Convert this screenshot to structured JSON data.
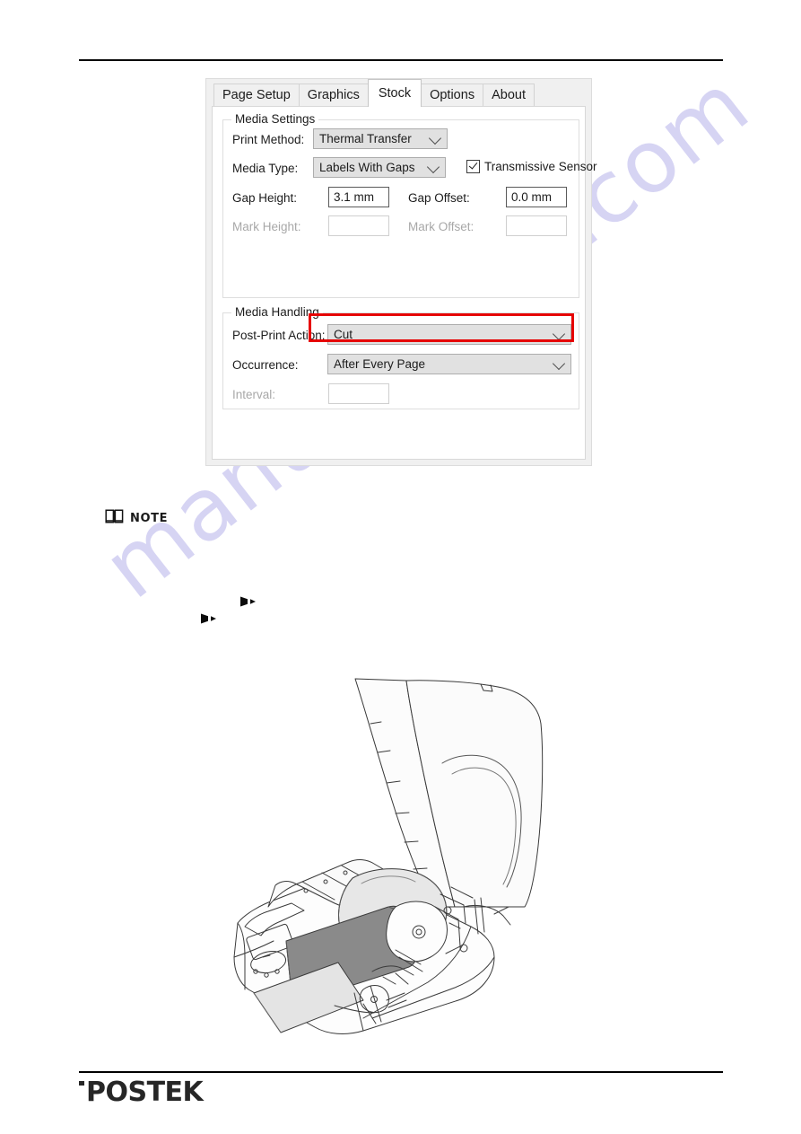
{
  "page": {
    "background": "#ffffff",
    "watermark_text": "manualshive.com",
    "watermark_color": "#c9c6f0"
  },
  "dialog": {
    "tabs": [
      {
        "label": "Page Setup",
        "active": false
      },
      {
        "label": "Graphics",
        "active": false
      },
      {
        "label": "Stock",
        "active": true
      },
      {
        "label": "Options",
        "active": false
      },
      {
        "label": "About",
        "active": false
      }
    ],
    "media_settings": {
      "title": "Media Settings",
      "print_method": {
        "label": "Print Method:",
        "value": "Thermal Transfer"
      },
      "media_type": {
        "label": "Media Type:",
        "value": "Labels With Gaps"
      },
      "transmissive_sensor": {
        "label": "Transmissive Sensor",
        "checked": true
      },
      "gap_height": {
        "label": "Gap Height:",
        "value": "3.1 mm",
        "enabled": true
      },
      "gap_offset": {
        "label": "Gap Offset:",
        "value": "0.0 mm",
        "enabled": true
      },
      "mark_height": {
        "label": "Mark Height:",
        "value": "",
        "enabled": false
      },
      "mark_offset": {
        "label": "Mark Offset:",
        "value": "",
        "enabled": false
      }
    },
    "media_handling": {
      "title": "Media Handling",
      "post_print_action": {
        "label": "Post-Print Action:",
        "value": "Cut",
        "highlighted": true,
        "highlight_color": "#e60000"
      },
      "occurrence": {
        "label": "Occurrence:",
        "value": "After Every Page"
      },
      "interval": {
        "label": "Interval:",
        "value": "",
        "enabled": false
      }
    }
  },
  "note": {
    "label": "NOTE",
    "icon": "book-icon"
  },
  "footer": {
    "logo_text": "POSTEK"
  }
}
